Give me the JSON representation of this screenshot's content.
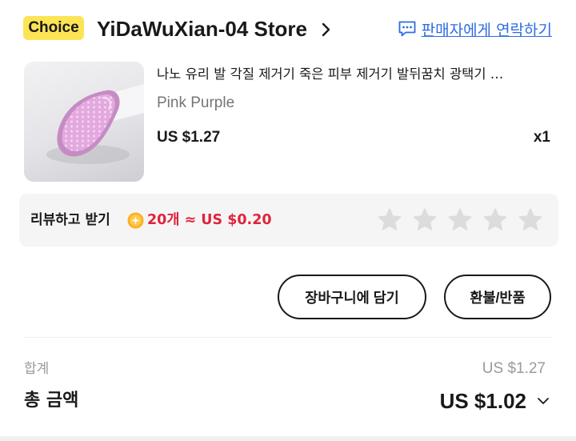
{
  "store": {
    "badge": "Choice",
    "name": "YiDaWuXian-04 Store",
    "contact_label": "판매자에게 연락하기"
  },
  "product": {
    "title": "나노 유리 발 각질 제거기 죽은 피부 제거기 발뒤꿈치 광택기 …",
    "variant": "Pink Purple",
    "price": "US $1.27",
    "quantity": "x1",
    "image_color": "#d9a3d6"
  },
  "review": {
    "label": "리뷰하고 받기",
    "reward": "20개 ≈ US $0.20",
    "reward_color": "#e0233d",
    "coin_icon": "coin-icon",
    "star_icon": "star-icon",
    "stars_total": 5,
    "stars_filled": 0
  },
  "actions": {
    "add_to_cart": "장바구니에 담기",
    "refund_return": "환불/반품"
  },
  "summary": {
    "subtotal_label": "합계",
    "subtotal_value": "US $1.27",
    "total_label": "총 금액",
    "total_value": "US $1.02"
  },
  "colors": {
    "choice_badge": "#fde455",
    "link": "#2d6ce0",
    "star_empty": "#dcdcdc"
  }
}
